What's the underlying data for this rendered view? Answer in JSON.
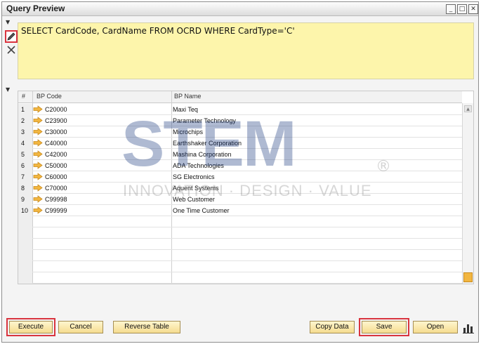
{
  "window": {
    "title": "Query Preview",
    "buttons": [
      "_",
      "□",
      "✕"
    ]
  },
  "query": {
    "text": "SELECT CardCode, CardName FROM OCRD WHERE CardType='C'"
  },
  "grid": {
    "headers": [
      "#",
      "BP Code",
      "BP Name"
    ],
    "rows": [
      {
        "num": "1",
        "code": "C20000",
        "name": "Maxi Teq"
      },
      {
        "num": "2",
        "code": "C23900",
        "name": "Parameter Technology"
      },
      {
        "num": "3",
        "code": "C30000",
        "name": "Microchips"
      },
      {
        "num": "4",
        "code": "C40000",
        "name": "Earthshaker Corporation"
      },
      {
        "num": "5",
        "code": "C42000",
        "name": "Mashina Corporation"
      },
      {
        "num": "6",
        "code": "C50000",
        "name": "ADA Technologies"
      },
      {
        "num": "7",
        "code": "C60000",
        "name": "SG Electronics"
      },
      {
        "num": "8",
        "code": "C70000",
        "name": "Aquent Systems"
      },
      {
        "num": "9",
        "code": "C99998",
        "name": "Web Customer"
      },
      {
        "num": "10",
        "code": "C99999",
        "name": "One Time Customer"
      }
    ]
  },
  "watermark": {
    "brand": "STEM",
    "tagline": "INNOVATION · DESIGN · VALUE",
    "registered": "®"
  },
  "buttons": {
    "execute": "Execute",
    "cancel": "Cancel",
    "reverse": "Reverse Table",
    "copy": "Copy Data",
    "save": "Save",
    "open": "Open"
  },
  "colors": {
    "query_bg": "#fdf5ab",
    "highlight": "#d9353f",
    "button_bg": "#f5dc8f",
    "link_arrow": "#f2b640"
  },
  "icons": [
    "pencil-icon",
    "tools-icon",
    "link-arrow-icon",
    "chart-icon"
  ]
}
